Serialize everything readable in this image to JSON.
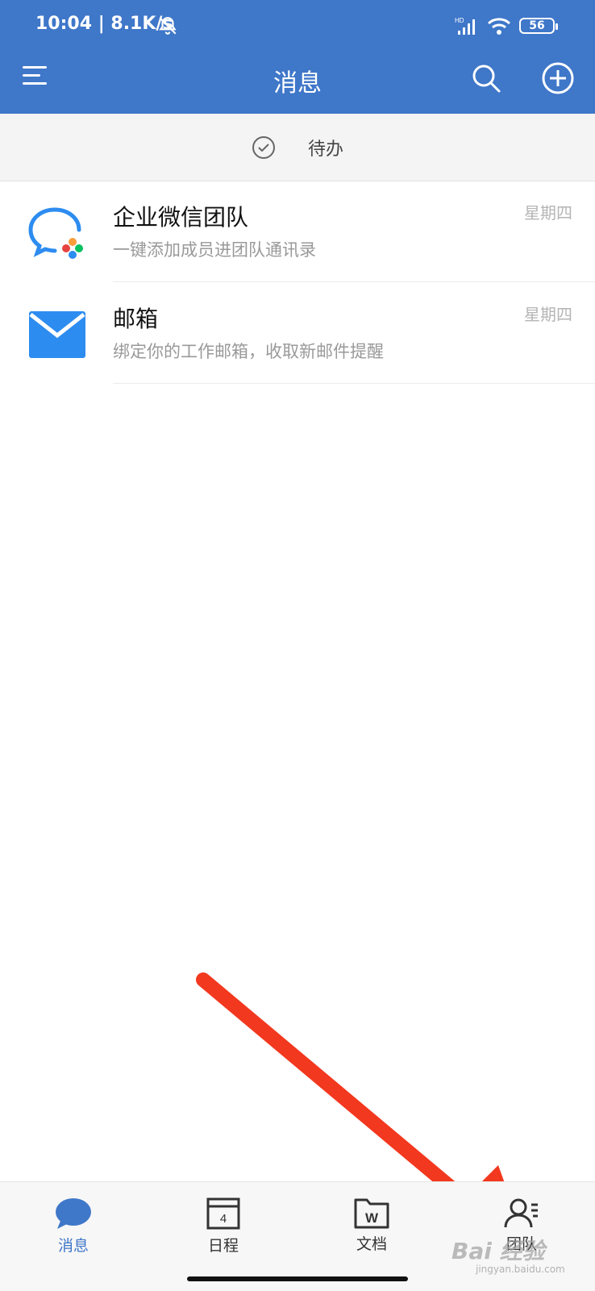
{
  "status_bar": {
    "time": "10:04 | 8.1K/s",
    "network": "HD",
    "battery": "56"
  },
  "header": {
    "title": "消息"
  },
  "todo": {
    "label": "待办"
  },
  "messages": [
    {
      "name": "企业微信团队",
      "preview": "一键添加成员进团队通讯录",
      "time": "星期四"
    },
    {
      "name": "邮箱",
      "preview": "绑定你的工作邮箱，收取新邮件提醒",
      "time": "星期四"
    }
  ],
  "tabs": [
    {
      "label": "消息",
      "active": true
    },
    {
      "label": "日程",
      "calendar_day": "4"
    },
    {
      "label": "文档",
      "icon_letter": "W"
    },
    {
      "label": "团队"
    }
  ],
  "watermark": {
    "text": "Bai 经验",
    "sub": "jingyan.baidu.com"
  },
  "colors": {
    "header": "#3f77c9",
    "accent": "#3f77c9",
    "arrow": "#f2381f"
  }
}
